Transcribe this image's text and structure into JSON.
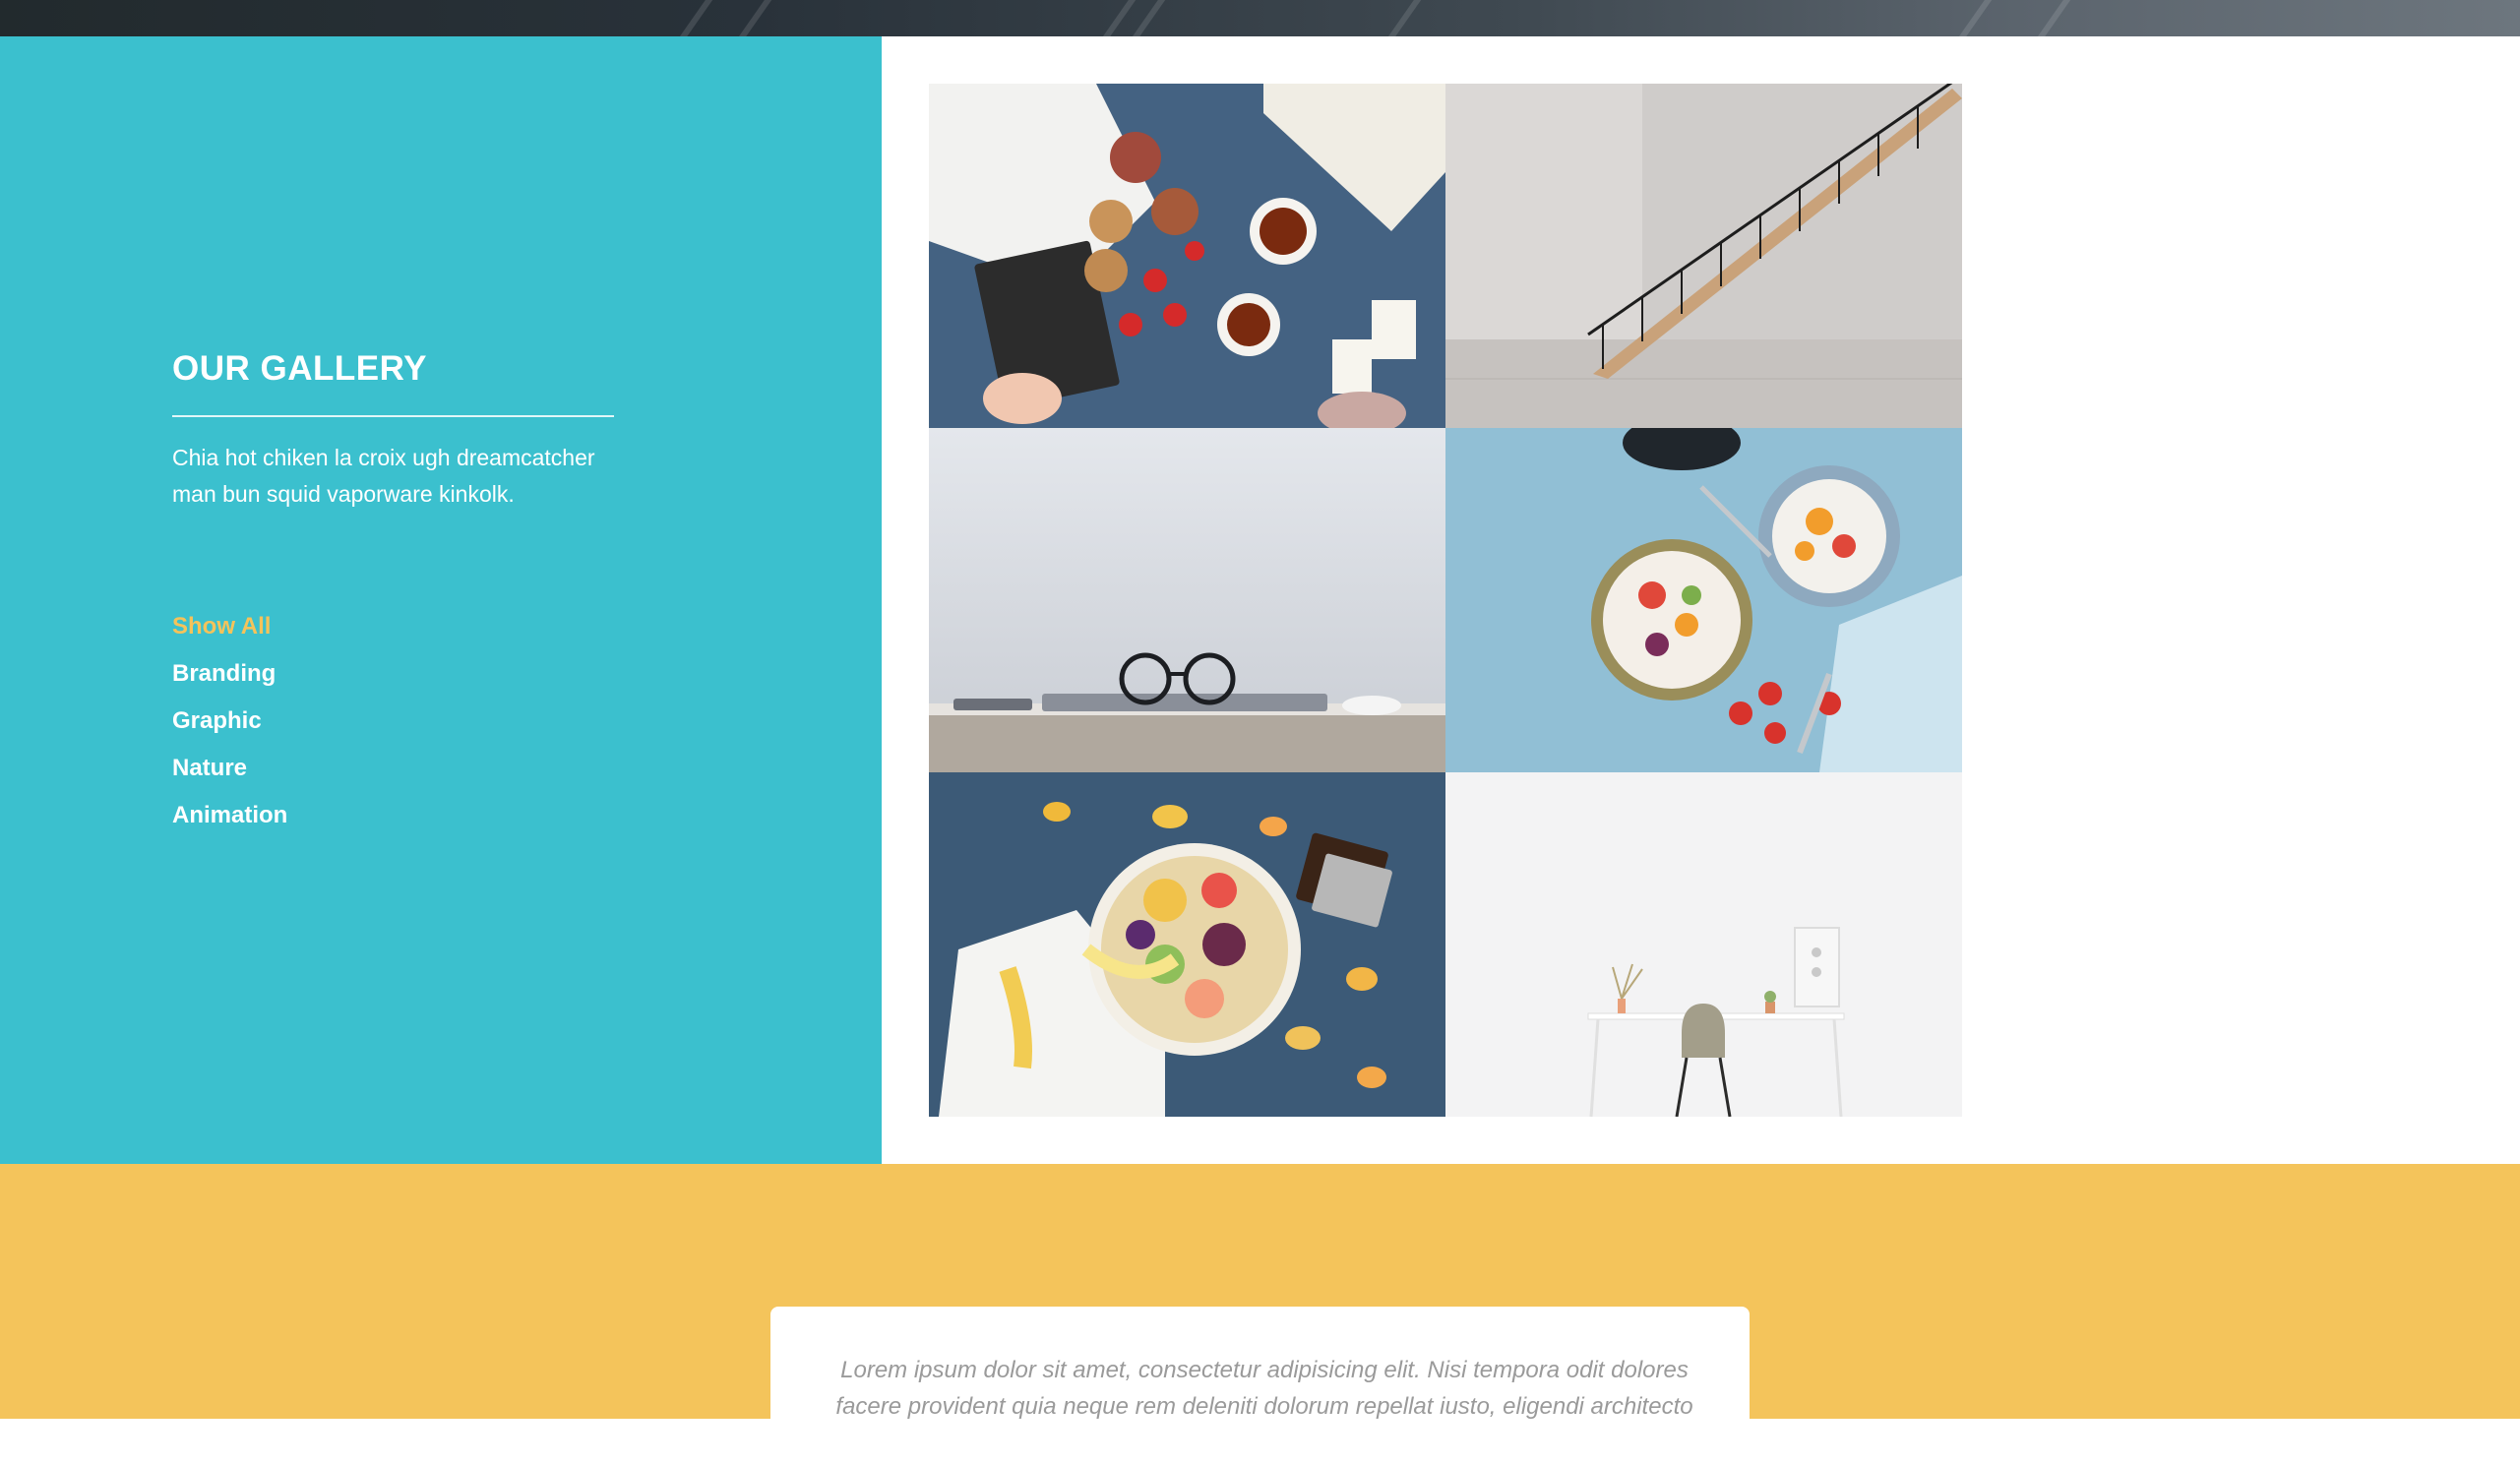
{
  "gallery": {
    "title": "OUR GALLERY",
    "description": "Chia hot chiken la croix ugh dreamcatcher man bun squid vaporware kinkolk.",
    "filters": [
      {
        "label": "Show All",
        "active": true
      },
      {
        "label": "Branding",
        "active": false
      },
      {
        "label": "Graphic",
        "active": false
      },
      {
        "label": "Nature",
        "active": false
      },
      {
        "label": "Animation",
        "active": false
      }
    ],
    "images": [
      {
        "subject": "breakfast-flatlay-tea-book"
      },
      {
        "subject": "staircase-white-wall"
      },
      {
        "subject": "glasses-laptop-desk"
      },
      {
        "subject": "fruit-yogurt-bowls"
      },
      {
        "subject": "fruit-platter-chocolate"
      },
      {
        "subject": "white-desk-chair"
      }
    ]
  },
  "testimonial": {
    "text": "Lorem ipsum dolor sit amet, consectetur adipisicing elit. Nisi tempora odit dolores facere provident quia neque rem deleniti dolorum repellat iusto, eligendi architecto"
  },
  "colors": {
    "sidebar": "#3bc0ce",
    "accent": "#f5c35a",
    "testimonial_bg": "#f4c45b"
  }
}
